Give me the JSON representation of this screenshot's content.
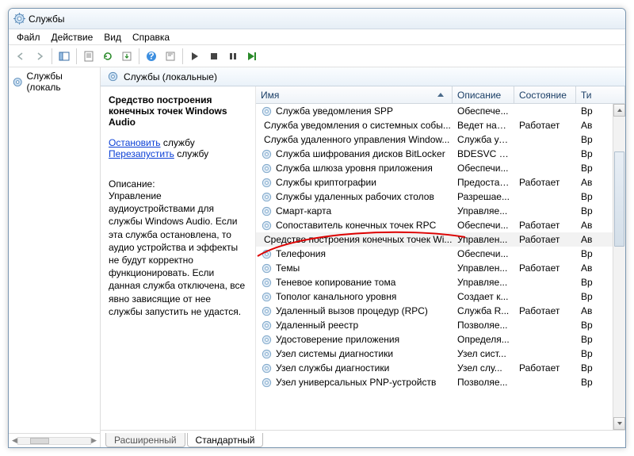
{
  "window": {
    "title": "Службы"
  },
  "menu": {
    "file": "Файл",
    "action": "Действие",
    "view": "Вид",
    "help": "Справка"
  },
  "leftnav": {
    "label": "Службы (локаль"
  },
  "header": {
    "label": "Службы (локальные)"
  },
  "detail": {
    "service_name": "Средство построения конечных точек Windows Audio",
    "stop_link": "Остановить",
    "stop_suffix": " службу",
    "restart_link": "Перезапустить",
    "restart_suffix": " службу",
    "desc_label": "Описание:",
    "desc_text": "Управление аудиоустройствами для службы Windows Audio.  Если эта служба остановлена, то аудио устройства и эффекты не будут корректно функционировать.  Если данная служба отключена, все явно зависящие от нее службы запустить не удастся."
  },
  "columns": {
    "name": "Имя",
    "description": "Описание",
    "status": "Состояние",
    "type": "Ти"
  },
  "rows": [
    {
      "name": "Служба уведомления SPP",
      "desc": "Обеспече...",
      "status": "",
      "type": "Вр"
    },
    {
      "name": "Служба уведомления о системных собы...",
      "desc": "Ведет наб...",
      "status": "Работает",
      "type": "Ав"
    },
    {
      "name": "Служба удаленного управления Window...",
      "desc": "Служба уд...",
      "status": "",
      "type": "Вр"
    },
    {
      "name": "Служба шифрования дисков BitLocker",
      "desc": "BDESVC пр...",
      "status": "",
      "type": "Вр"
    },
    {
      "name": "Служба шлюза уровня приложения",
      "desc": "Обеспечи...",
      "status": "",
      "type": "Вр"
    },
    {
      "name": "Службы криптографии",
      "desc": "Предостав...",
      "status": "Работает",
      "type": "Ав"
    },
    {
      "name": "Службы удаленных рабочих столов",
      "desc": "Разрешае...",
      "status": "",
      "type": "Вр"
    },
    {
      "name": "Смарт-карта",
      "desc": "Управляе...",
      "status": "",
      "type": "Вр"
    },
    {
      "name": "Сопоставитель конечных точек RPC",
      "desc": "Обеспечи...",
      "status": "Работает",
      "type": "Ав"
    },
    {
      "name": "Средство построения конечных точек Wi...",
      "desc": "Управлен...",
      "status": "Работает",
      "type": "Ав",
      "selected": true
    },
    {
      "name": "Телефония",
      "desc": "Обеспечи...",
      "status": "",
      "type": "Вр"
    },
    {
      "name": "Темы",
      "desc": "Управлен...",
      "status": "Работает",
      "type": "Ав"
    },
    {
      "name": "Теневое копирование тома",
      "desc": "Управляе...",
      "status": "",
      "type": "Вр"
    },
    {
      "name": "Тополог канального уровня",
      "desc": "Создает к...",
      "status": "",
      "type": "Вр"
    },
    {
      "name": "Удаленный вызов процедур (RPC)",
      "desc": "Служба R...",
      "status": "Работает",
      "type": "Ав"
    },
    {
      "name": "Удаленный реестр",
      "desc": "Позволяе...",
      "status": "",
      "type": "Вр"
    },
    {
      "name": "Удостоверение приложения",
      "desc": "Определя...",
      "status": "",
      "type": "Вр"
    },
    {
      "name": "Узел системы диагностики",
      "desc": "Узел сист...",
      "status": "",
      "type": "Вр"
    },
    {
      "name": "Узел службы диагностики",
      "desc": "Узел слу...",
      "status": "Работает",
      "type": "Вр"
    },
    {
      "name": "Узел универсальных PNP-устройств",
      "desc": "Позволяе...",
      "status": "",
      "type": "Вр"
    }
  ],
  "tabs": {
    "extended": "Расширенный",
    "standard": "Стандартный"
  }
}
